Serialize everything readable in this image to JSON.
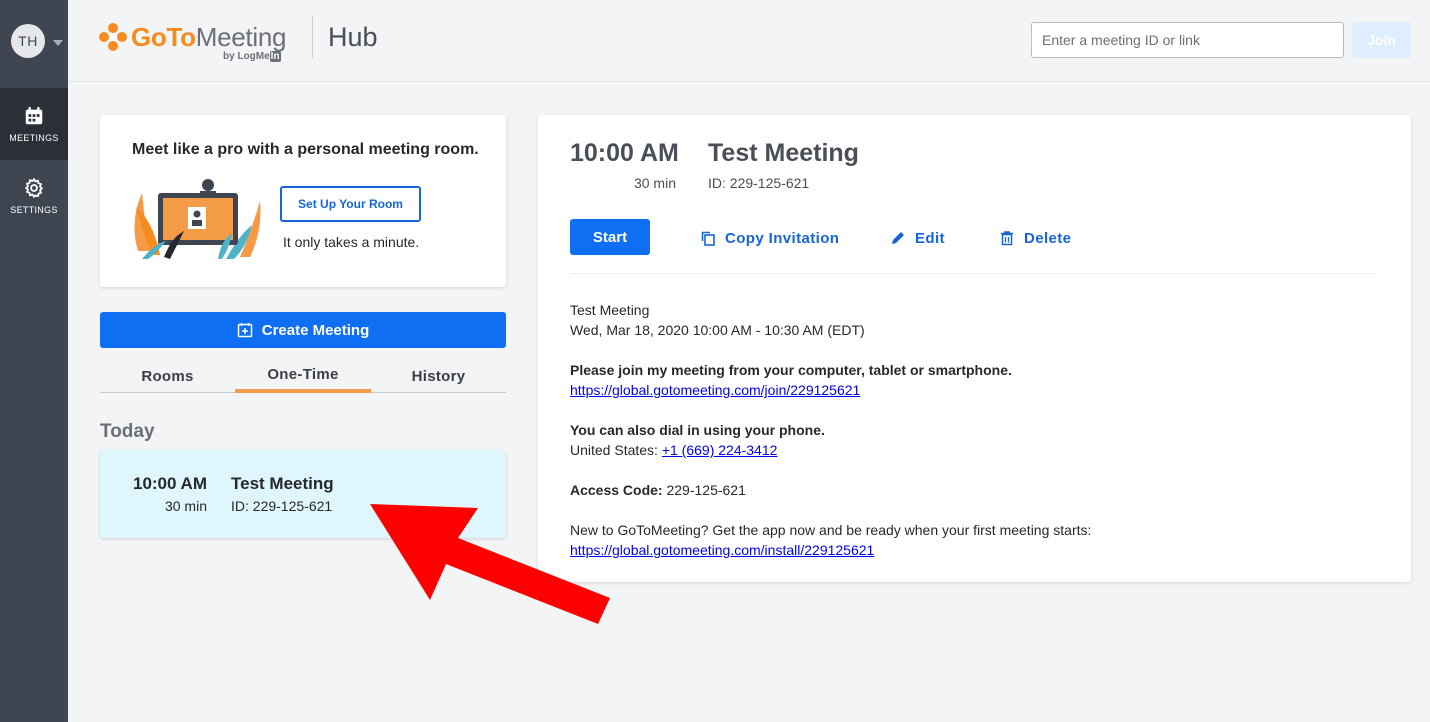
{
  "user": {
    "initials": "TH"
  },
  "rail": {
    "meetings_label": "MEETINGS",
    "settings_label": "SETTINGS"
  },
  "header": {
    "logo_goto": "GoTo",
    "logo_meeting": "Meeting",
    "logo_by": "by LogMe",
    "logo_in": "In",
    "title": "Hub",
    "meeting_input_placeholder": "Enter a meeting ID or link",
    "join_label": "Join"
  },
  "promo": {
    "title": "Meet like a pro with a personal meeting room.",
    "button_label": "Set Up Your Room",
    "subtitle": "It only takes a minute."
  },
  "create_meeting_label": "Create Meeting",
  "tabs": [
    {
      "label": "Rooms",
      "selected": false
    },
    {
      "label": "One-Time",
      "selected": true
    },
    {
      "label": "History",
      "selected": false
    }
  ],
  "section_label": "Today",
  "meetings": [
    {
      "time": "10:00 AM",
      "duration": "30 min",
      "title": "Test Meeting",
      "id": "ID: 229-125-621"
    }
  ],
  "detail": {
    "time": "10:00 AM",
    "duration": "30 min",
    "title": "Test Meeting",
    "id": "ID: 229-125-621",
    "start_label": "Start",
    "copy_label": "Copy Invitation",
    "edit_label": "Edit",
    "delete_label": "Delete",
    "invitation": {
      "name": "Test Meeting",
      "datetime": "Wed, Mar 18, 2020 10:00 AM - 10:30 AM (EDT)",
      "join_heading": "Please join my meeting from your computer, tablet or smartphone.",
      "join_link": "https://global.gotomeeting.com/join/229125621",
      "dial_heading": "You can also dial in using your phone.",
      "dial_country": "United States: ",
      "dial_number": "+1 (669) 224-3412",
      "access_label": "Access Code:",
      "access_code": " 229-125-621",
      "new_text": "New to GoToMeeting? Get the app now and be ready when your first meeting starts:",
      "install_link": "https://global.gotomeeting.com/install/229125621"
    }
  },
  "colors": {
    "rail": "#3f4652",
    "rail_active": "#2a2f38",
    "primary": "#0f6ff2",
    "link_blue": "#1665d8",
    "brand_orange": "#f68b1f",
    "tab_indicator": "#f39b46",
    "selected_row": "#e0f6fd",
    "annotation_arrow": "#ff0000"
  }
}
